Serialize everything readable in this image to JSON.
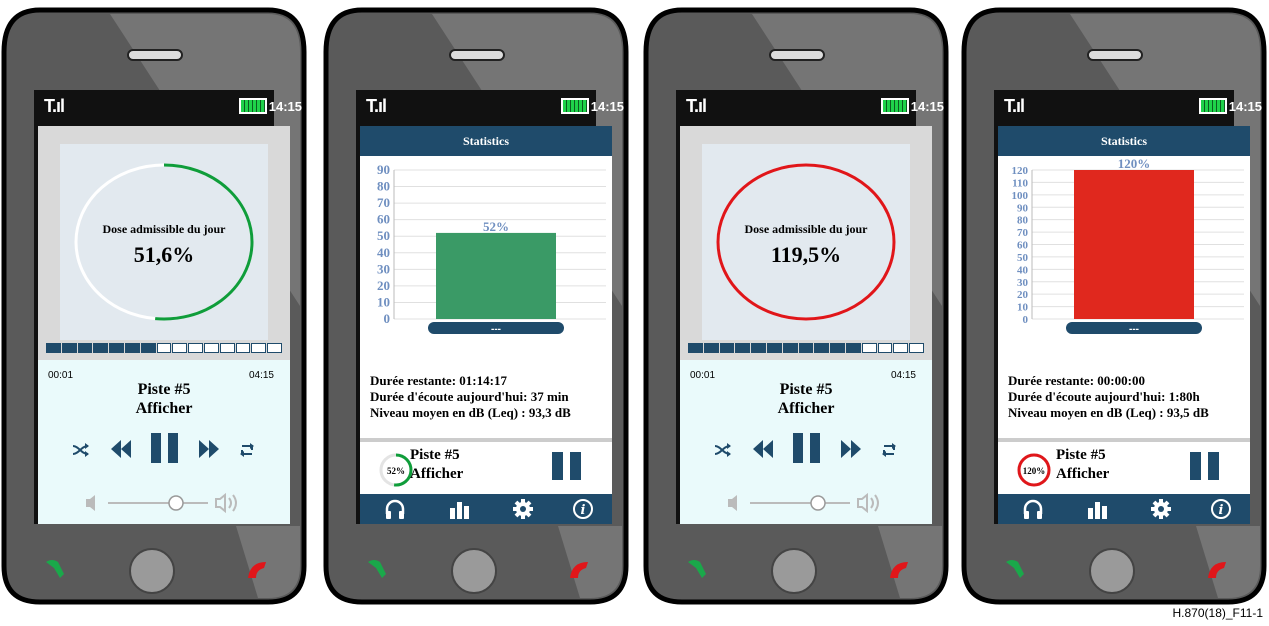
{
  "status_bar": {
    "signal": "T.ıl",
    "time": "14:15"
  },
  "phone1": {
    "dose_label": "Dose admissible du jour",
    "dose_value": "51,6%",
    "dose_fraction": 0.516,
    "ring_color": "#0f9d3a",
    "progress_filled": 7,
    "progress_total": 15,
    "time_elapsed": "00:01",
    "time_total": "04:15",
    "track_title": "Piste #5",
    "track_action": "Afficher",
    "volume_level": 0.68
  },
  "phone2": {
    "header": "Statistics",
    "chart_data": {
      "type": "bar",
      "values": [
        52
      ],
      "data_label": "52%",
      "bar_color": "#3a9a66",
      "ylim": [
        0,
        90
      ],
      "yticks": [
        "0",
        "10",
        "20",
        "30",
        "40",
        "50",
        "60",
        "70",
        "80",
        "90"
      ],
      "category_label": "---",
      "grid": true
    },
    "info_lines": [
      "Durée restante: 01:14:17",
      "Durée d'écoute aujourd'hui: 37 min",
      "Niveau moyen en dB (Leq) : 93,3 dB"
    ],
    "mini_ring_label": "52%",
    "mini_ring_fraction": 0.52,
    "mini_ring_color": "#0f9d3a",
    "track_title": "Piste #5",
    "track_action": "Afficher"
  },
  "phone3": {
    "dose_label": "Dose admissible du jour",
    "dose_value": "119,5%",
    "dose_fraction": 1.0,
    "ring_color": "#e0161a",
    "progress_filled": 11,
    "progress_total": 15,
    "time_elapsed": "00:01",
    "time_total": "04:15",
    "track_title": "Piste #5",
    "track_action": "Afficher",
    "volume_level": 0.68
  },
  "phone4": {
    "header": "Statistics",
    "chart_data": {
      "type": "bar",
      "values": [
        120
      ],
      "data_label": "120%",
      "bar_color": "#e0281e",
      "ylim": [
        0,
        120
      ],
      "yticks": [
        "0",
        "10",
        "20",
        "30",
        "40",
        "50",
        "60",
        "70",
        "80",
        "90",
        "100",
        "110",
        "120"
      ],
      "category_label": "---",
      "grid": true
    },
    "info_lines": [
      "Durée restante: 00:00:00",
      "Durée d'écoute aujourd'hui: 1:80h",
      "Niveau moyen en dB (Leq) : 93,5 dB"
    ],
    "mini_ring_label": "120%",
    "mini_ring_fraction": 1.0,
    "mini_ring_color": "#e0161a",
    "track_title": "Piste #5",
    "track_action": "Afficher"
  },
  "figure_id": "H.870(18)_F11-1",
  "colors": {
    "accent": "#1f4b6b",
    "tick": "#6f8fc0",
    "call": "#1aa84a",
    "hangup": "#e0161a"
  }
}
